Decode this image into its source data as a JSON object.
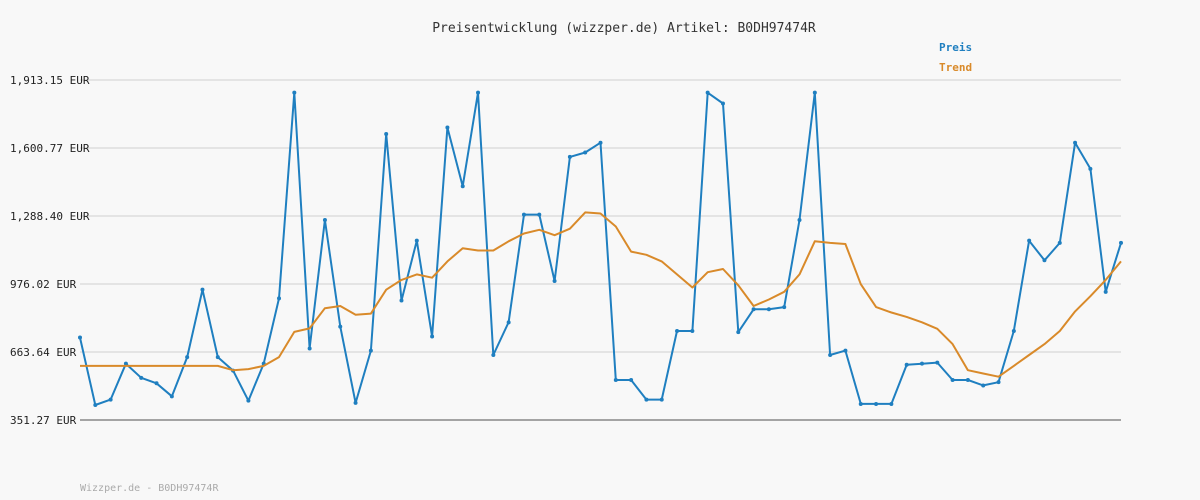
{
  "chart_data": {
    "type": "line",
    "title": "Preisentwicklung (wizzper.de) Artikel: B0DH97474R",
    "footer": "Wizzper.de - B0DH97474R",
    "currency": "EUR",
    "y_ticks": [
      351.27,
      663.64,
      976.02,
      1288.4,
      1600.77,
      1913.15
    ],
    "y_tick_labels": [
      "351.27 EUR",
      "663.64 EUR",
      "976.02 EUR",
      "1,288.40 EUR",
      "1,600.77 EUR",
      "1,913.15 EUR"
    ],
    "ylim": [
      351.27,
      1913.15
    ],
    "grid": true,
    "legend_position": "top-right",
    "x": [
      0,
      1,
      2,
      3,
      4,
      5,
      6,
      7,
      8,
      9,
      10,
      11,
      12,
      13,
      14,
      15,
      16,
      17,
      18,
      19,
      20,
      21,
      22,
      23,
      24,
      25,
      26,
      27,
      28,
      29,
      30,
      31,
      32,
      33,
      34,
      35,
      36,
      37,
      38,
      39,
      40,
      41,
      42,
      43,
      44,
      45,
      46,
      47,
      48,
      49,
      50,
      51,
      52,
      53,
      54,
      55,
      56,
      57,
      58,
      59,
      60,
      61,
      62,
      63,
      64,
      65,
      66,
      67,
      68
    ],
    "xlim": [
      0,
      68
    ],
    "series": [
      {
        "name": "Preis",
        "color": "#1f7fc0",
        "values": [
          730,
          420,
          445,
          610,
          545,
          520,
          460,
          640,
          950,
          640,
          578,
          440,
          610,
          910,
          1855,
          680,
          1270,
          780,
          430,
          670,
          1665,
          900,
          1175,
          735,
          1695,
          1425,
          1855,
          650,
          800,
          1295,
          1295,
          990,
          1560,
          1580,
          1625,
          535,
          535,
          445,
          445,
          760,
          760,
          1855,
          1805,
          755,
          860,
          860,
          870,
          1270,
          1855,
          650,
          670,
          425,
          425,
          425,
          605,
          610,
          615,
          535,
          535,
          510,
          525,
          760,
          1175,
          1085,
          1165,
          1625,
          1505,
          940,
          1165
        ]
      },
      {
        "name": "Trend",
        "color": "#d98a2a",
        "values": [
          600,
          600,
          600,
          600,
          600,
          600,
          600,
          600,
          600,
          600,
          580,
          585,
          600,
          640,
          756,
          772,
          865,
          875,
          835,
          840,
          950,
          995,
          1020,
          1005,
          1080,
          1140,
          1130,
          1130,
          1172,
          1208,
          1225,
          1200,
          1230,
          1305,
          1300,
          1240,
          1125,
          1110,
          1080,
          1020,
          960,
          1030,
          1045,
          970,
          875,
          905,
          940,
          1020,
          1172,
          1165,
          1160,
          975,
          870,
          845,
          825,
          800,
          770,
          700,
          580,
          565,
          550,
          600,
          650,
          700,
          760,
          850,
          920,
          995,
          1080
        ]
      }
    ]
  }
}
